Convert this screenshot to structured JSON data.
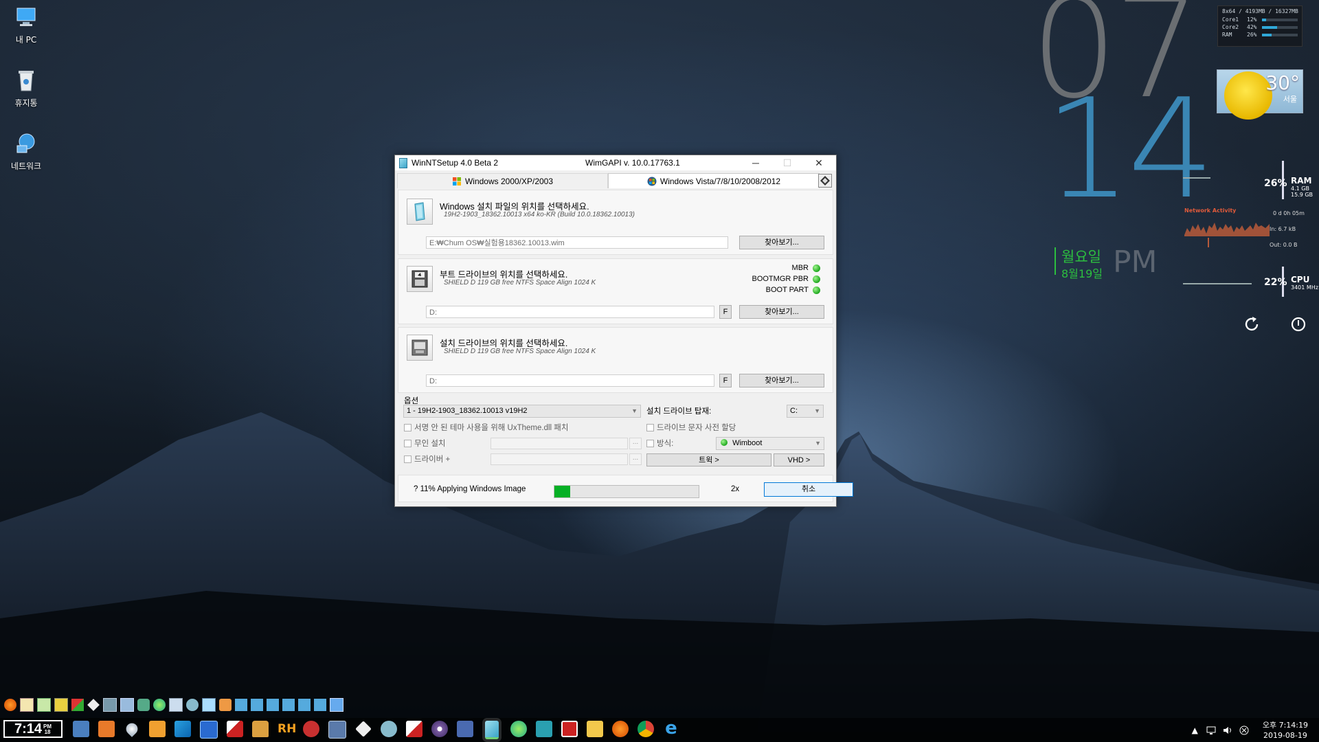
{
  "desktop": {
    "icons": [
      {
        "label": "내 PC",
        "icon": "this-pc-icon"
      },
      {
        "label": "휴지통",
        "icon": "recycle-bin-icon"
      },
      {
        "label": "네트워크",
        "icon": "network-icon"
      }
    ]
  },
  "clock_widget": {
    "hour": "07",
    "minute": "14",
    "day_name": "월요일",
    "date": "8월19일",
    "ampm": "PM"
  },
  "sys_widget": {
    "header": "8x64 / 4193MB / 16327MB",
    "rows": [
      {
        "k": "Core1",
        "v": "12%",
        "level": 0.12
      },
      {
        "k": "Core2",
        "v": "42%",
        "level": 0.42
      },
      {
        "k": "RAM",
        "v": "26%",
        "level": 0.26
      }
    ]
  },
  "weather": {
    "temp": "30°",
    "city": "서울"
  },
  "ram_meter": {
    "pct": "26%",
    "label": "RAM",
    "used": "4.1 GB",
    "total": "15.9 GB"
  },
  "network": {
    "label": "Network Activity",
    "uptime": "0 d 0h 05m",
    "in": "In: 6.7 kB",
    "out": "Out: 0.0 B"
  },
  "cpu_meter": {
    "pct": "22%",
    "label": "CPU",
    "freq": "3401 MHz"
  },
  "window": {
    "title": "WinNTSetup 4.0 Beta 2",
    "wimgapi": "WimGAPI v. 10.0.17763.1",
    "controls": {
      "minimize": "─",
      "maximize": "☐",
      "close": "✕"
    },
    "tabs": [
      {
        "label": "Windows 2000/XP/2003",
        "active": false
      },
      {
        "label": "Windows Vista/7/8/10/2008/2012",
        "active": true
      }
    ],
    "source": {
      "title": "Windows 설치 파일의 위치를 선택하세요.",
      "sub": "19H2-1903_18362.10013  x64 ko-KR (Build 10.0.18362.10013)",
      "path": "E:₩Chum OS₩실험용18362.10013.wim",
      "browse": "찾아보기..."
    },
    "boot": {
      "title": "부트 드라이브의 위치를 선택하세요.",
      "sub": "SHIELD D 119 GB free NTFS Space Align 1024 K",
      "path": "D:",
      "f_button": "F",
      "browse": "찾아보기...",
      "status": [
        {
          "label": "MBR",
          "color": "#1fa81f"
        },
        {
          "label": "BOOTMGR PBR",
          "color": "#1fa81f"
        },
        {
          "label": "BOOT PART",
          "color": "#1fa81f"
        }
      ]
    },
    "install": {
      "title": "설치 드라이브의 위치를 선택하세요.",
      "sub": "SHIELD D 119 GB free NTFS Space Align 1024 K",
      "path": "D:",
      "f_button": "F",
      "browse": "찾아보기..."
    },
    "options": {
      "label": "옵션",
      "edition": "1 - 19H2-1903_18362.10013 v19H2",
      "mount_label": "설치 드라이브 탑재:",
      "mount_value": "C:",
      "uxtheme": "서명 안 된 테마 사용을 위해 UxTheme.dll 패치",
      "preassign": "드라이브 문자 사전 할당",
      "unattend": "무인 설치",
      "mode_label": "방식:",
      "mode_value": "Wimboot",
      "drivers": "드라이버 +",
      "tweaks": "트윅 >",
      "vhd": "VHD >",
      "ellipsis": "..."
    },
    "progress": {
      "text": "? 11% Applying Windows Image",
      "value": 0.11,
      "speed": "2x",
      "cancel": "취소"
    }
  },
  "taskbar": {
    "clock": "7:14",
    "clock_small_top": "PM",
    "clock_small_bottom": "18",
    "tray_time": "오후 7:14:19",
    "tray_date": "2019-08-19"
  }
}
